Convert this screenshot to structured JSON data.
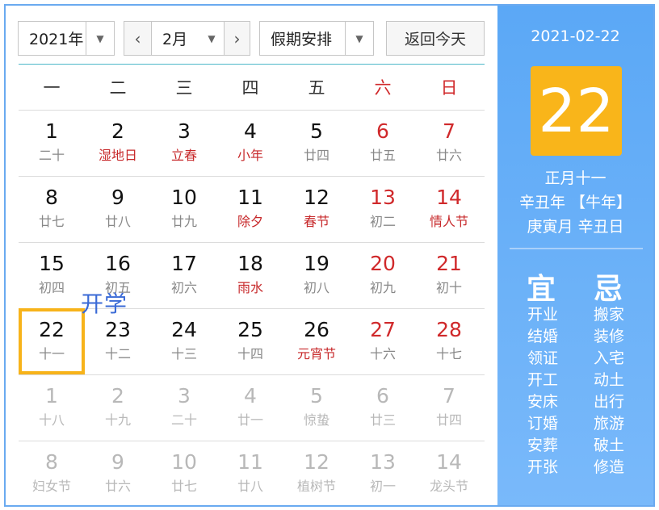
{
  "toolbar": {
    "year": "2021年",
    "prev": "‹",
    "month": "2月",
    "next": "›",
    "holiday": "假期安排",
    "today_button": "返回今天"
  },
  "weekdays": [
    "一",
    "二",
    "三",
    "四",
    "五",
    "六",
    "日"
  ],
  "weeks": [
    [
      {
        "n": "1",
        "l": "二十",
        "wk": false,
        "fest": false,
        "other": false
      },
      {
        "n": "2",
        "l": "湿地日",
        "wk": false,
        "fest": true,
        "other": false
      },
      {
        "n": "3",
        "l": "立春",
        "wk": false,
        "fest": true,
        "other": false
      },
      {
        "n": "4",
        "l": "小年",
        "wk": false,
        "fest": true,
        "other": false
      },
      {
        "n": "5",
        "l": "廿四",
        "wk": false,
        "fest": false,
        "other": false
      },
      {
        "n": "6",
        "l": "廿五",
        "wk": true,
        "fest": false,
        "other": false
      },
      {
        "n": "7",
        "l": "廿六",
        "wk": true,
        "fest": false,
        "other": false
      }
    ],
    [
      {
        "n": "8",
        "l": "廿七",
        "wk": false,
        "fest": false,
        "other": false
      },
      {
        "n": "9",
        "l": "廿八",
        "wk": false,
        "fest": false,
        "other": false
      },
      {
        "n": "10",
        "l": "廿九",
        "wk": false,
        "fest": false,
        "other": false
      },
      {
        "n": "11",
        "l": "除夕",
        "wk": false,
        "fest": true,
        "other": false
      },
      {
        "n": "12",
        "l": "春节",
        "wk": false,
        "fest": true,
        "other": false
      },
      {
        "n": "13",
        "l": "初二",
        "wk": true,
        "fest": false,
        "other": false
      },
      {
        "n": "14",
        "l": "情人节",
        "wk": true,
        "fest": true,
        "other": false
      }
    ],
    [
      {
        "n": "15",
        "l": "初四",
        "wk": false,
        "fest": false,
        "other": false
      },
      {
        "n": "16",
        "l": "初五",
        "wk": false,
        "fest": false,
        "other": false
      },
      {
        "n": "17",
        "l": "初六",
        "wk": false,
        "fest": false,
        "other": false
      },
      {
        "n": "18",
        "l": "雨水",
        "wk": false,
        "fest": true,
        "other": false
      },
      {
        "n": "19",
        "l": "初八",
        "wk": false,
        "fest": false,
        "other": false
      },
      {
        "n": "20",
        "l": "初九",
        "wk": true,
        "fest": false,
        "other": false
      },
      {
        "n": "21",
        "l": "初十",
        "wk": true,
        "fest": false,
        "other": false
      }
    ],
    [
      {
        "n": "22",
        "l": "十一",
        "wk": false,
        "fest": false,
        "other": false,
        "selected": true
      },
      {
        "n": "23",
        "l": "十二",
        "wk": false,
        "fest": false,
        "other": false
      },
      {
        "n": "24",
        "l": "十三",
        "wk": false,
        "fest": false,
        "other": false
      },
      {
        "n": "25",
        "l": "十四",
        "wk": false,
        "fest": false,
        "other": false
      },
      {
        "n": "26",
        "l": "元宵节",
        "wk": false,
        "fest": true,
        "other": false
      },
      {
        "n": "27",
        "l": "十六",
        "wk": true,
        "fest": false,
        "other": false
      },
      {
        "n": "28",
        "l": "十七",
        "wk": true,
        "fest": false,
        "other": false
      }
    ],
    [
      {
        "n": "1",
        "l": "十八",
        "wk": false,
        "fest": false,
        "other": true
      },
      {
        "n": "2",
        "l": "十九",
        "wk": false,
        "fest": false,
        "other": true
      },
      {
        "n": "3",
        "l": "二十",
        "wk": false,
        "fest": false,
        "other": true
      },
      {
        "n": "4",
        "l": "廿一",
        "wk": false,
        "fest": false,
        "other": true
      },
      {
        "n": "5",
        "l": "惊蛰",
        "wk": false,
        "fest": false,
        "other": true
      },
      {
        "n": "6",
        "l": "廿三",
        "wk": false,
        "fest": false,
        "other": true
      },
      {
        "n": "7",
        "l": "廿四",
        "wk": false,
        "fest": false,
        "other": true
      }
    ],
    [
      {
        "n": "8",
        "l": "妇女节",
        "wk": false,
        "fest": false,
        "other": true
      },
      {
        "n": "9",
        "l": "廿六",
        "wk": false,
        "fest": false,
        "other": true
      },
      {
        "n": "10",
        "l": "廿七",
        "wk": false,
        "fest": false,
        "other": true
      },
      {
        "n": "11",
        "l": "廿八",
        "wk": false,
        "fest": false,
        "other": true
      },
      {
        "n": "12",
        "l": "植树节",
        "wk": false,
        "fest": false,
        "other": true
      },
      {
        "n": "13",
        "l": "初一",
        "wk": false,
        "fest": false,
        "other": true
      },
      {
        "n": "14",
        "l": "龙头节",
        "wk": false,
        "fest": false,
        "other": true
      }
    ]
  ],
  "overlay_text": "开学",
  "panel": {
    "date": "2021-02-22",
    "day": "22",
    "lunar_date": "正月十一",
    "year_line": "辛丑年 【牛年】",
    "ganzhi": "庚寅月 辛丑日",
    "yi_label": "宜",
    "ji_label": "忌",
    "yi": [
      "开业",
      "结婚",
      "领证",
      "开工",
      "安床",
      "订婚",
      "安葬",
      "开张"
    ],
    "ji": [
      "搬家",
      "装修",
      "入宅",
      "动土",
      "出行",
      "旅游",
      "破土",
      "修造"
    ]
  },
  "colors": {
    "accent": "#f9b51a",
    "panel_blue": "#5ba8f6",
    "holiday_red": "#d0292b",
    "overlay_blue": "#3a6ad6"
  }
}
